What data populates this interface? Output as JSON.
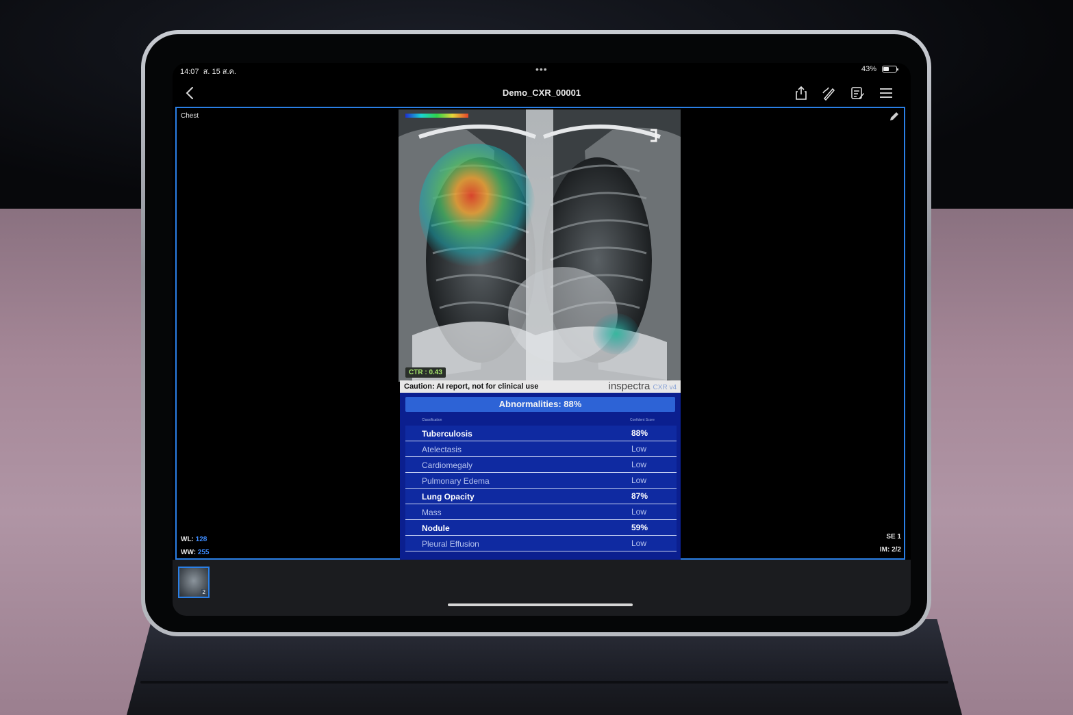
{
  "status_bar": {
    "time": "14:07",
    "date": "ส. 15 ส.ค.",
    "battery": "43%",
    "more": "•••"
  },
  "navbar": {
    "title": "Demo_CXR_00001",
    "icons": [
      "back-icon",
      "share-icon",
      "annotate-icon",
      "report-icon",
      "menu-icon"
    ]
  },
  "viewer": {
    "body_part": "Chest",
    "wl_label": "WL:",
    "wl_value": "128",
    "ww_label": "WW:",
    "ww_value": "255",
    "series": "SE 1",
    "image": "IM: 2/2",
    "ctr": "CTR : 0.43"
  },
  "report": {
    "caution": "Caution: AI report, not for clinical use",
    "brand": "inspectra",
    "brand_sub": "CXR v4",
    "abnormalities": "Abnormalities: 88%",
    "col_classification": "Classification",
    "col_score": "Confident Score",
    "rows": [
      {
        "name": "Tuberculosis",
        "score": "88%",
        "highlight": true
      },
      {
        "name": "Atelectasis",
        "score": "Low",
        "highlight": false
      },
      {
        "name": "Cardiomegaly",
        "score": "Low",
        "highlight": false
      },
      {
        "name": "Pulmonary Edema",
        "score": "Low",
        "highlight": false
      },
      {
        "name": "Lung Opacity",
        "score": "87%",
        "highlight": true
      },
      {
        "name": "Mass",
        "score": "Low",
        "highlight": false
      },
      {
        "name": "Nodule",
        "score": "59%",
        "highlight": true
      },
      {
        "name": "Pleural Effusion",
        "score": "Low",
        "highlight": false
      }
    ]
  },
  "thumbnails": [
    {
      "badge": "2"
    }
  ],
  "colors": {
    "accent_blue": "#2a7fe6",
    "report_bg": "#0b1f8f",
    "abnormal_bar": "#2d63d6",
    "wl_value": "#3d8cff",
    "ctr_text": "#a3e36b"
  }
}
